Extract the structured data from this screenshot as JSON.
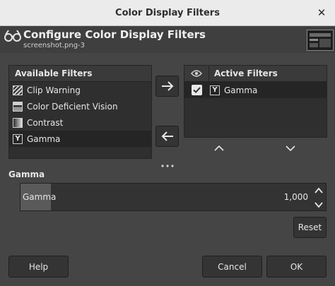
{
  "window": {
    "title": "Color Display Filters"
  },
  "header": {
    "title": "Configure Color Display Filters",
    "subtitle": "screenshot.png-3"
  },
  "available": {
    "heading": "Available Filters",
    "items": [
      {
        "label": "Clip Warning",
        "icon": "clip-warning-icon"
      },
      {
        "label": "Color Deficient Vision",
        "icon": "color-deficient-vision-icon"
      },
      {
        "label": "Contrast",
        "icon": "contrast-icon"
      },
      {
        "label": "Gamma",
        "icon": "gamma-icon",
        "selected": true
      }
    ]
  },
  "active": {
    "heading": "Active Filters",
    "items": [
      {
        "label": "Gamma",
        "icon": "gamma-icon",
        "enabled": true
      }
    ]
  },
  "filter_config": {
    "section_label": "Gamma",
    "field_label": "Gamma",
    "value_text": "1,000",
    "value": 1.0,
    "fill_fraction": 0.1
  },
  "buttons": {
    "reset": "Reset",
    "help": "Help",
    "cancel": "Cancel",
    "ok": "OK"
  },
  "colors": {
    "background": "#454545",
    "titlebar": "#ebebeb",
    "list_background": "#2f2f2f",
    "selected_row": "#252525"
  }
}
